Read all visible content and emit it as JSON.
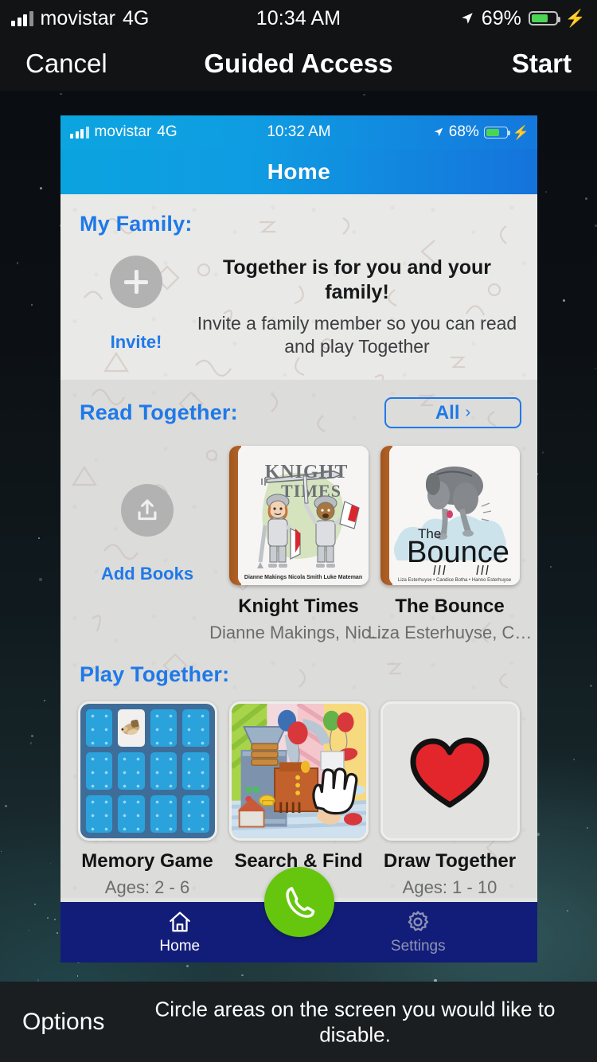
{
  "guided_access": {
    "status_bar": {
      "carrier": "movistar",
      "network": "4G",
      "time": "10:34 AM",
      "battery_percent": "69%",
      "battery_level": 69,
      "location_icon": "location-arrow-icon",
      "charging_icon": "bolt-icon"
    },
    "nav": {
      "cancel_label": "Cancel",
      "title": "Guided Access",
      "start_label": "Start"
    },
    "options": {
      "label": "Options",
      "hint": "Circle areas on the screen you would like to disable."
    }
  },
  "app": {
    "status_bar": {
      "carrier": "movistar",
      "network": "4G",
      "time": "10:32 AM",
      "battery_percent": "68%",
      "battery_level": 68
    },
    "header": {
      "title": "Home"
    },
    "family": {
      "section_title": "My Family:",
      "invite_button_icon": "plus-icon",
      "invite_label": "Invite!",
      "headline": "Together is for you and your family!",
      "subtext": "Invite a family member so you can read and play Together"
    },
    "read": {
      "section_title": "Read Together:",
      "all_button_label": "All",
      "all_button_chevron": "chevron-right-icon",
      "add_books": {
        "icon": "upload-icon",
        "label": "Add Books"
      },
      "books": [
        {
          "title": "Knight Times",
          "authors": "Dianne Makings, Nic…",
          "cover_title_line1": "KNIGHT",
          "cover_title_line2": "TIMES",
          "cover_credits": "Dianne Makings   Nicola Smith   Luke Mateman"
        },
        {
          "title": "The Bounce",
          "authors": "Liza Esterhuyse, C…",
          "cover_title_line1": "The",
          "cover_title_line2": "Bounce",
          "cover_credits": "Liza Esterhuyse • Candice Botha • Hanno Esterhuyse"
        }
      ]
    },
    "play": {
      "section_title": "Play Together:",
      "games": [
        {
          "title": "Memory Game",
          "ages": "Ages: 2 - 6",
          "icon": "memory-cards-icon"
        },
        {
          "title": "Search & Find",
          "ages": "",
          "icon": "hand-pointer-icon"
        },
        {
          "title": "Draw Together",
          "ages": "Ages: 1 - 10",
          "icon": "heart-icon"
        }
      ]
    },
    "tabbar": {
      "tabs": [
        {
          "label": "Home",
          "icon": "home-icon",
          "active": true
        },
        {
          "label": "Settings",
          "icon": "gear-icon",
          "active": false
        }
      ],
      "call_button_icon": "phone-icon"
    }
  },
  "colors": {
    "accent_blue": "#1f79e8",
    "header_blue_start": "#0ba3df",
    "header_blue_end": "#1573dc",
    "tabbar_navy": "#121d79",
    "fab_green": "#66c60e",
    "battery_green": "#4cd554",
    "heart_red": "#e3262c"
  }
}
